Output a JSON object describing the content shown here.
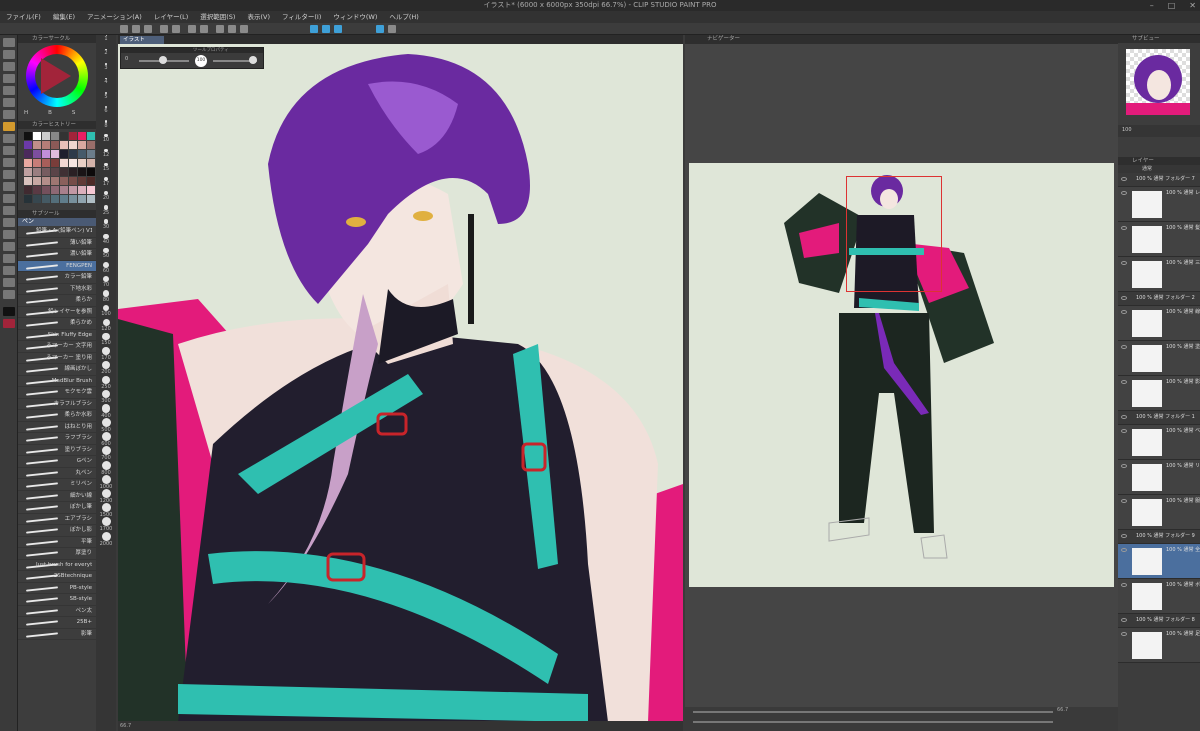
{
  "window": {
    "title": "イラスト* (6000 x 6000px 350dpi 66.7%) - CLIP STUDIO PAINT PRO"
  },
  "menu": [
    "ファイル(F)",
    "編集(E)",
    "アニメーション(A)",
    "レイヤー(L)",
    "選択範囲(S)",
    "表示(V)",
    "フィルター(I)",
    "ウィンドウ(W)",
    "ヘルプ(H)"
  ],
  "panels": {
    "color_circle": "カラーサークル",
    "color_history": "カラーヒストリー",
    "subtool": "サブツール",
    "subtool_group": "ペン",
    "navigator": "ナビゲーター",
    "layer": "レイヤー",
    "preview": "サブビュー",
    "tool_property": "ツールプロパティ"
  },
  "canvas_tab": "イラスト",
  "brush_size_label": "100",
  "brush_opacity": "0",
  "color_values": [
    "H",
    "B",
    "S"
  ],
  "brushes": [
    "鉛筆・A (鉛筆ペン) V1",
    "薄い鉛筆",
    "濃い鉛筆",
    "FENGPEN",
    "カラー鉛筆",
    "下地水彩",
    "柔らか",
    "鉛レイヤーを参照",
    "柔らかめ",
    "Skin Fluffy Edge",
    "ろマーカー 文字用",
    "ろマーカー 塗り用",
    "線画ぼかし",
    "MadBlur Brush",
    "モクモク雲",
    "カラフルブラシ",
    "柔らか水彩",
    "はねとり用",
    "ラフブラシ",
    "塗りブラシ",
    "Gペン",
    "丸ペン",
    "ミリペン",
    "細かい線",
    "ぼかし筆",
    "エアブラシ",
    "ぼかし影",
    "平筆",
    "厚塗り",
    "Just brush for everything",
    "2SBtechnique",
    "PB-style",
    "SB-style",
    "ペン太",
    "25B+",
    "影筆"
  ],
  "brush_sizes": [
    "1",
    "2",
    "3",
    "4",
    "5",
    "6",
    "8",
    "10",
    "12",
    "15",
    "17",
    "20",
    "25",
    "30",
    "40",
    "50",
    "60",
    "70",
    "80",
    "100",
    "120",
    "150",
    "170",
    "200",
    "250",
    "300",
    "400",
    "500",
    "600",
    "700",
    "800",
    "1000",
    "1200",
    "1500",
    "1700",
    "2000"
  ],
  "swatch_colors": [
    "#111111",
    "#ffffff",
    "#cccccc",
    "#888888",
    "#333333",
    "#a2243a",
    "#e91e63",
    "#2fbfb0",
    "#6b3aa8",
    "#c08f8a",
    "#b57d77",
    "#8c5a57",
    "#e8c0b8",
    "#f0d6cf",
    "#d8a8a0",
    "#996e6a",
    "#4b2a5c",
    "#7d4e9e",
    "#c28fd8",
    "#e0bcdc",
    "#1f1f2e",
    "#2e3a4a",
    "#465a6a",
    "#6b7c8a",
    "#e9a8a0",
    "#c77d78",
    "#a85e5a",
    "#7a3d3a",
    "#f2d7d2",
    "#f7e5e1",
    "#ead0c6",
    "#d4b3aa",
    "#bfa0a0",
    "#9a7e80",
    "#765c60",
    "#5a4448",
    "#3f3034",
    "#2a2024",
    "#1a1416",
    "#0d0a0b",
    "#d9c2bd",
    "#c7a8a3",
    "#b38e8a",
    "#9e7672",
    "#8a605c",
    "#764c48",
    "#613a36",
    "#4d2a27",
    "#402a30",
    "#5a3a44",
    "#74505c",
    "#8e6874",
    "#a8808c",
    "#c298a4",
    "#dcb0bc",
    "#f6c8d4",
    "#263238",
    "#37474f",
    "#455a64",
    "#546e7a",
    "#607d8b",
    "#78909c",
    "#90a4ae",
    "#b0bec5"
  ],
  "layers": [
    {
      "type": "folder",
      "name": "100 % 通常 フォルダー 7"
    },
    {
      "type": "layer",
      "name": "100 % 通常 レイヤー"
    },
    {
      "type": "layer",
      "name": "100 % 通常 髪"
    },
    {
      "type": "layer",
      "name": "100 % 通常 三つ編み"
    },
    {
      "type": "folder",
      "name": "100 % 通常 フォルダー 2"
    },
    {
      "type": "layer",
      "name": "100 % 通常 線画"
    },
    {
      "type": "layer",
      "name": "100 % 通常 塗り"
    },
    {
      "type": "layer",
      "name": "100 % 通常 影"
    },
    {
      "type": "folder",
      "name": "100 % 通常 フォルダー 1"
    },
    {
      "type": "layer",
      "name": "100 % 通常 ベルト"
    },
    {
      "type": "layer",
      "name": "100 % 通常 リボン"
    },
    {
      "type": "layer",
      "name": "100 % 通常 服"
    },
    {
      "type": "folder",
      "name": "100 % 通常 フォルダー 9"
    },
    {
      "type": "layer",
      "name": "100 % 通常 全身",
      "selected": true
    },
    {
      "type": "layer",
      "name": "100 % 通常 ボタン"
    },
    {
      "type": "folder",
      "name": "100 % 通常 フォルダー 8"
    },
    {
      "type": "layer",
      "name": "100 % 通常 足"
    }
  ],
  "navigator_zoom": "66.7",
  "status_zoom": "66.7",
  "layer_blend": "通常",
  "layer_opacity": "100"
}
